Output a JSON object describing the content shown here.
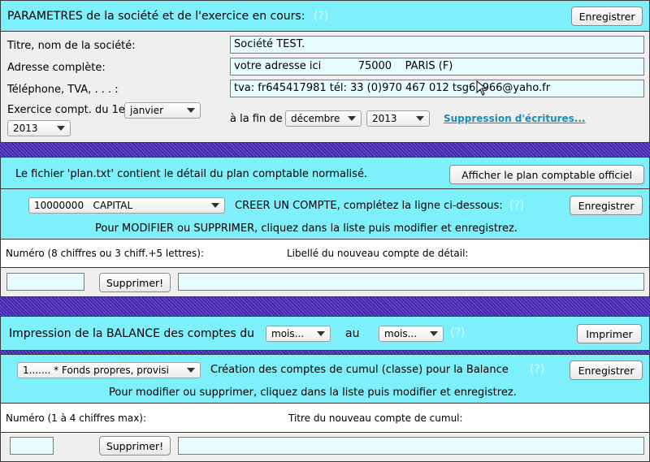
{
  "params": {
    "title": "PARAMETRES de la société et de l'exercice en cours:",
    "help": "(?)",
    "save_label": "Enregistrer",
    "company_label": "Titre, nom de la société:",
    "company_value": "Société TEST.",
    "address_label": "Adresse complète:",
    "address_value": "votre adresse ici           75000    PARIS (F)",
    "phone_label": "Téléphone, TVA, . . . :",
    "phone_value": "tva: fr645417981  tél:  33 (0)970 467 012  tsg61966@yaho.fr",
    "fiscal_start_label": "Exercice compt. du 1er",
    "start_month": "janvier",
    "start_year": "2013",
    "fiscal_end_label": "à la fin de",
    "end_month": "décembre",
    "end_year": "2013",
    "delete_link": "Suppression d'écritures..."
  },
  "plan": {
    "info_text": "Le fichier 'plan.txt' contient le détail du plan comptable normalisé.",
    "show_plan_label": "Afficher le plan comptable officiel"
  },
  "account": {
    "select_value": "10000000   CAPITAL",
    "create_text": "CREER UN COMPTE, complétez la ligne ci-dessous:",
    "help": "(?)",
    "save_label": "Enregistrer",
    "modify_text": "Pour MODIFIER ou SUPPRIMER, cliquez dans la liste puis modifier et enregistrez.",
    "number_label": "Numéro (8 chiffres ou 3 chiff.+5 lettres):",
    "name_label": "Libellé du nouveau compte de détail:",
    "number_value": "",
    "name_value": "",
    "delete_label": "Supprimer!"
  },
  "balance": {
    "text": "Impression de la BALANCE des comptes du",
    "from_month": "mois...",
    "to_label": "au",
    "to_month": "mois...",
    "help": "(?)",
    "print_label": "Imprimer"
  },
  "cumul": {
    "select_value": "1....... * Fonds propres, provisi",
    "create_text": "Création des comptes de cumul (classe) pour la Balance",
    "help": "(?)",
    "save_label": "Enregistrer",
    "modify_text": "Pour modifier ou supprimer, cliquez dans la liste puis modifier et enregistrez.",
    "number_label": "Numéro (1 à 4 chiffres max):",
    "name_label": "Titre du nouveau compte de cumul:",
    "number_value": "",
    "name_value": "",
    "delete_label": "Supprimer!"
  }
}
